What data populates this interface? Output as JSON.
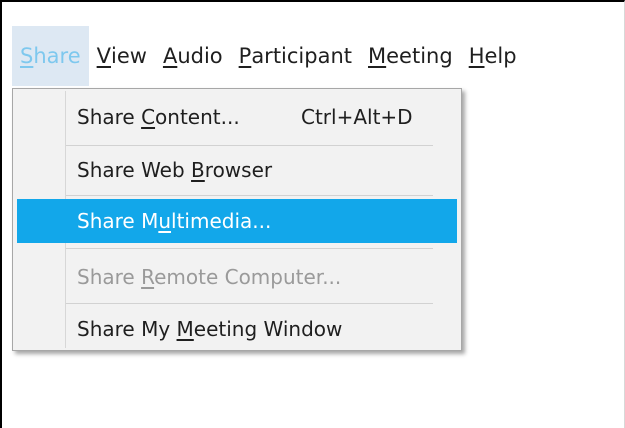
{
  "menubar": {
    "items": [
      {
        "pre": "",
        "key": "S",
        "post": "hare",
        "active": true
      },
      {
        "pre": "",
        "key": "V",
        "post": "iew",
        "active": false
      },
      {
        "pre": "",
        "key": "A",
        "post": "udio",
        "active": false
      },
      {
        "pre": "",
        "key": "P",
        "post": "articipant",
        "active": false
      },
      {
        "pre": "",
        "key": "M",
        "post": "eeting",
        "active": false
      },
      {
        "pre": "",
        "key": "H",
        "post": "elp",
        "active": false
      }
    ]
  },
  "share_menu": {
    "items": [
      {
        "pre": "Share ",
        "key": "C",
        "post": "ontent...",
        "shortcut": "Ctrl+Alt+D",
        "state": "normal"
      },
      {
        "pre": "Share Web ",
        "key": "B",
        "post": "rowser",
        "shortcut": "",
        "state": "normal"
      },
      {
        "pre": "Share M",
        "key": "u",
        "post": "ltimedia...",
        "shortcut": "",
        "state": "highlighted"
      },
      {
        "pre": "Share ",
        "key": "R",
        "post": "emote Computer...",
        "shortcut": "",
        "state": "disabled"
      },
      {
        "pre": "Share My ",
        "key": "M",
        "post": "eeting Window",
        "shortcut": "",
        "state": "normal"
      }
    ]
  },
  "colors": {
    "highlight": "#12a7ea",
    "menu_active_bg": "#dde8f3",
    "disabled_text": "#9a9a9a"
  }
}
